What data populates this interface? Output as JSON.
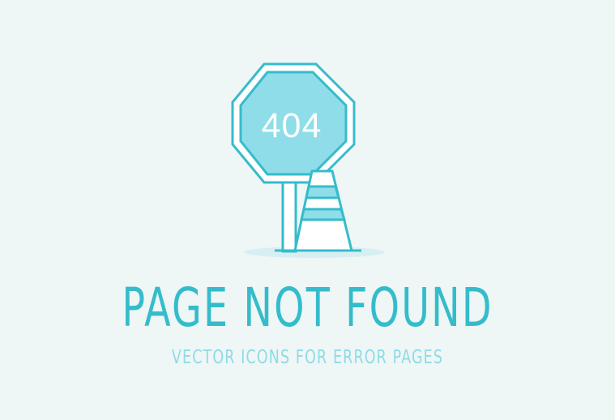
{
  "illustration": {
    "sign_text": "404",
    "colors": {
      "background": "#eef6f6",
      "outline": "#35bccb",
      "sign_fill": "#8fdde8",
      "white": "#ffffff",
      "shadow": "#d7eff2"
    },
    "icons": [
      "stop-sign-icon",
      "traffic-cone-icon"
    ]
  },
  "headline": "PAGE NOT FOUND",
  "subheadline": "VECTOR ICONS FOR ERROR PAGES"
}
